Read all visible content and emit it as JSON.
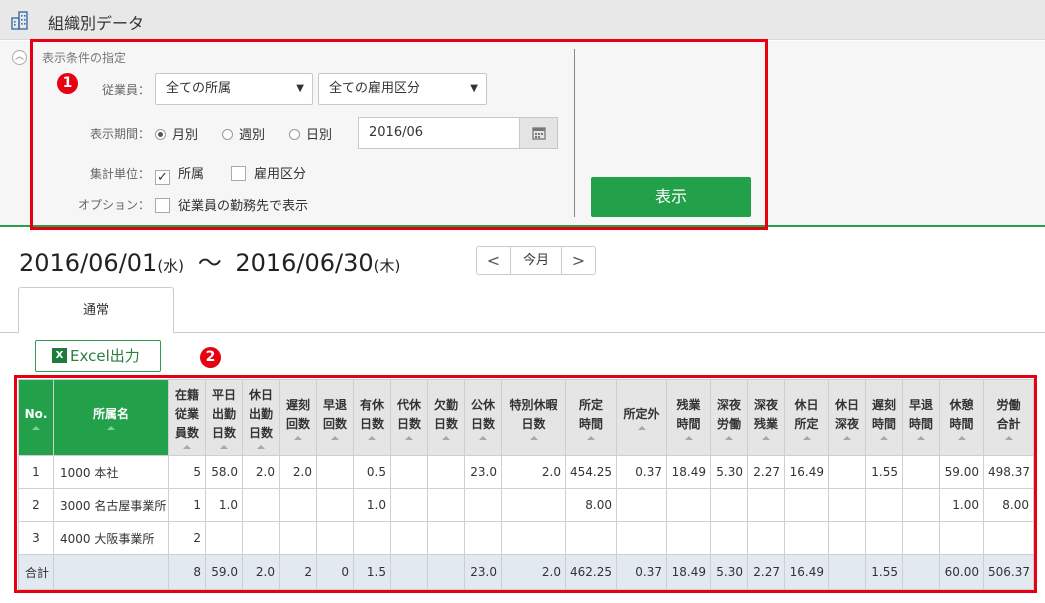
{
  "title": "組織別データ",
  "conditions": {
    "heading": "表示条件の指定",
    "employee_label": "従業員：",
    "department_select": "全ての所属",
    "employment_select": "全ての雇用区分",
    "period_label": "表示期間：",
    "period_options": [
      "月別",
      "週別",
      "日別"
    ],
    "period_selected": "月別",
    "date_value": "2016/06",
    "unit_label": "集計単位：",
    "unit_department": "所属",
    "unit_department_checked": true,
    "unit_employment": "雇用区分",
    "unit_employment_checked": false,
    "option_label": "オプション：",
    "option_text": "従業員の勤務先で表示",
    "option_checked": false,
    "show_button": "表示",
    "badge": "1"
  },
  "range": {
    "start": "2016/06/01",
    "start_day": "(水)",
    "sep": "〜",
    "end": "2016/06/30",
    "end_day": "(木)"
  },
  "nav": {
    "prev": "<",
    "today": "今月",
    "next": ">"
  },
  "tab": "通常",
  "excel_button": "Excel出力",
  "table_badge": "2",
  "table": {
    "columns": [
      [
        "No."
      ],
      [
        "所属名"
      ],
      [
        "在籍",
        "従業",
        "員数"
      ],
      [
        "平日",
        "出勤",
        "日数"
      ],
      [
        "休日",
        "出勤",
        "日数"
      ],
      [
        "遅刻",
        "回数"
      ],
      [
        "早退",
        "回数"
      ],
      [
        "有休",
        "日数"
      ],
      [
        "代休",
        "日数"
      ],
      [
        "欠勤",
        "日数"
      ],
      [
        "公休",
        "日数"
      ],
      [
        "特別休暇",
        "日数"
      ],
      [
        "所定",
        "時間"
      ],
      [
        "所定外"
      ],
      [
        "残業",
        "時間"
      ],
      [
        "深夜",
        "労働"
      ],
      [
        "深夜",
        "残業"
      ],
      [
        "休日",
        "所定"
      ],
      [
        "休日",
        "深夜"
      ],
      [
        "遅刻",
        "時間"
      ],
      [
        "早退",
        "時間"
      ],
      [
        "休憩",
        "時間"
      ],
      [
        "労働",
        "合計"
      ]
    ],
    "rows": [
      [
        "1",
        "1000 本社",
        "5",
        "58.0",
        "2.0",
        "2.0",
        "",
        "0.5",
        "",
        "",
        "23.0",
        "2.0",
        "454.25",
        "0.37",
        "18.49",
        "5.30",
        "2.27",
        "16.49",
        "",
        "1.55",
        "",
        "59.00",
        "498.37"
      ],
      [
        "2",
        "3000 名古屋事業所",
        "1",
        "1.0",
        "",
        "",
        "",
        "1.0",
        "",
        "",
        "",
        "",
        "8.00",
        "",
        "",
        "",
        "",
        "",
        "",
        "",
        "",
        "1.00",
        "8.00"
      ],
      [
        "3",
        "4000 大阪事業所",
        "2",
        "",
        "",
        "",
        "",
        "",
        "",
        "",
        "",
        "",
        "",
        "",
        "",
        "",
        "",
        "",
        "",
        "",
        "",
        "",
        ""
      ]
    ],
    "total": [
      "合計",
      "",
      "8",
      "59.0",
      "2.0",
      "2",
      "0",
      "1.5",
      "",
      "",
      "23.0",
      "2.0",
      "462.25",
      "0.37",
      "18.49",
      "5.30",
      "2.27",
      "16.49",
      "",
      "1.55",
      "",
      "60.00",
      "506.37"
    ]
  },
  "colors": {
    "accent_green": "#23a04a",
    "highlight_red": "#e60012",
    "total_row": "#e2e9f1"
  },
  "icons": {
    "title": "building-icon",
    "collapse": "chevron-up-icon",
    "calendar": "calendar-icon",
    "excel": "excel-icon"
  }
}
